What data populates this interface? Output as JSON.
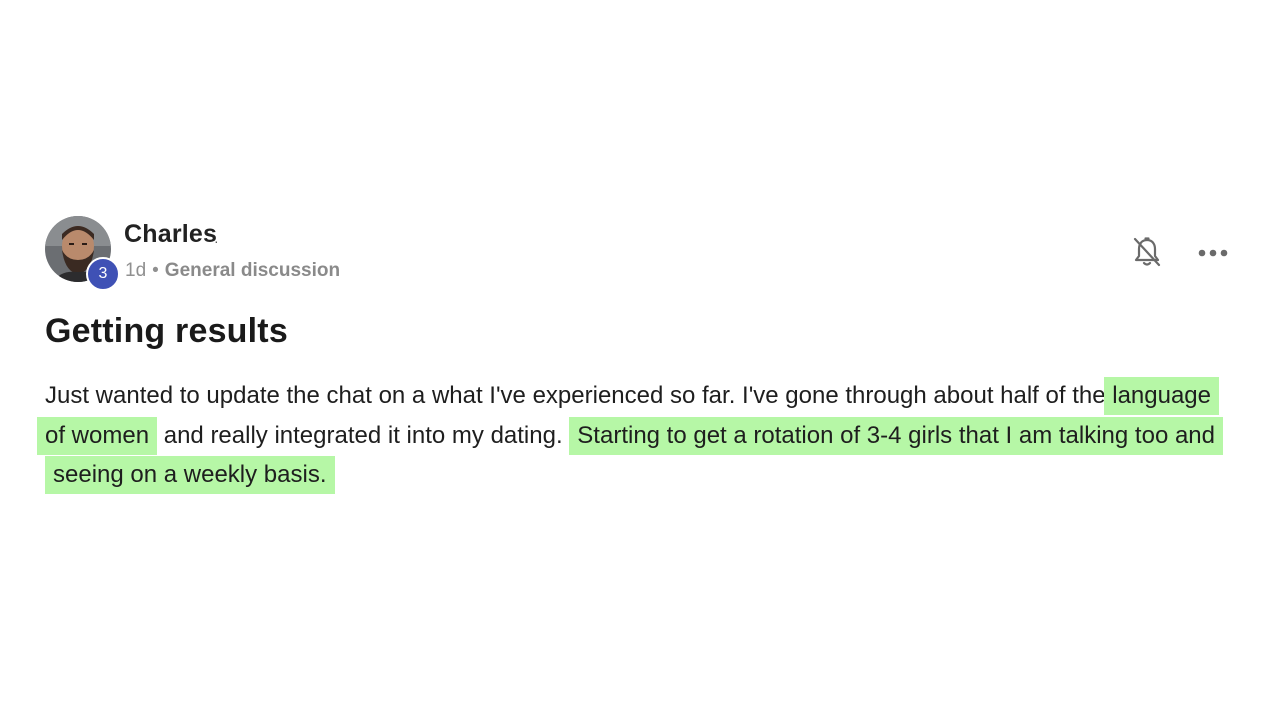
{
  "post": {
    "author": {
      "name": "Charles",
      "level": "3",
      "avatar_icon": "user-avatar"
    },
    "meta": {
      "time": "1d",
      "separator": "•",
      "category": "General discussion"
    },
    "actions": {
      "notifications_icon": "bell-off-icon",
      "more_icon": "more-horizontal-icon"
    },
    "title": "Getting results",
    "body": {
      "text_1": "Just wanted to update the chat on a what I've experienced so far. I've gone through about half of the ",
      "highlight_1": "language of women",
      "text_2": " and really integrated it into my dating. ",
      "highlight_2": "Starting to get a rotation of 3-4 girls that I am talking too and seeing on a weekly basis. "
    },
    "colors": {
      "highlight": "#b6f7a6",
      "badge": "#3f51b5"
    }
  }
}
